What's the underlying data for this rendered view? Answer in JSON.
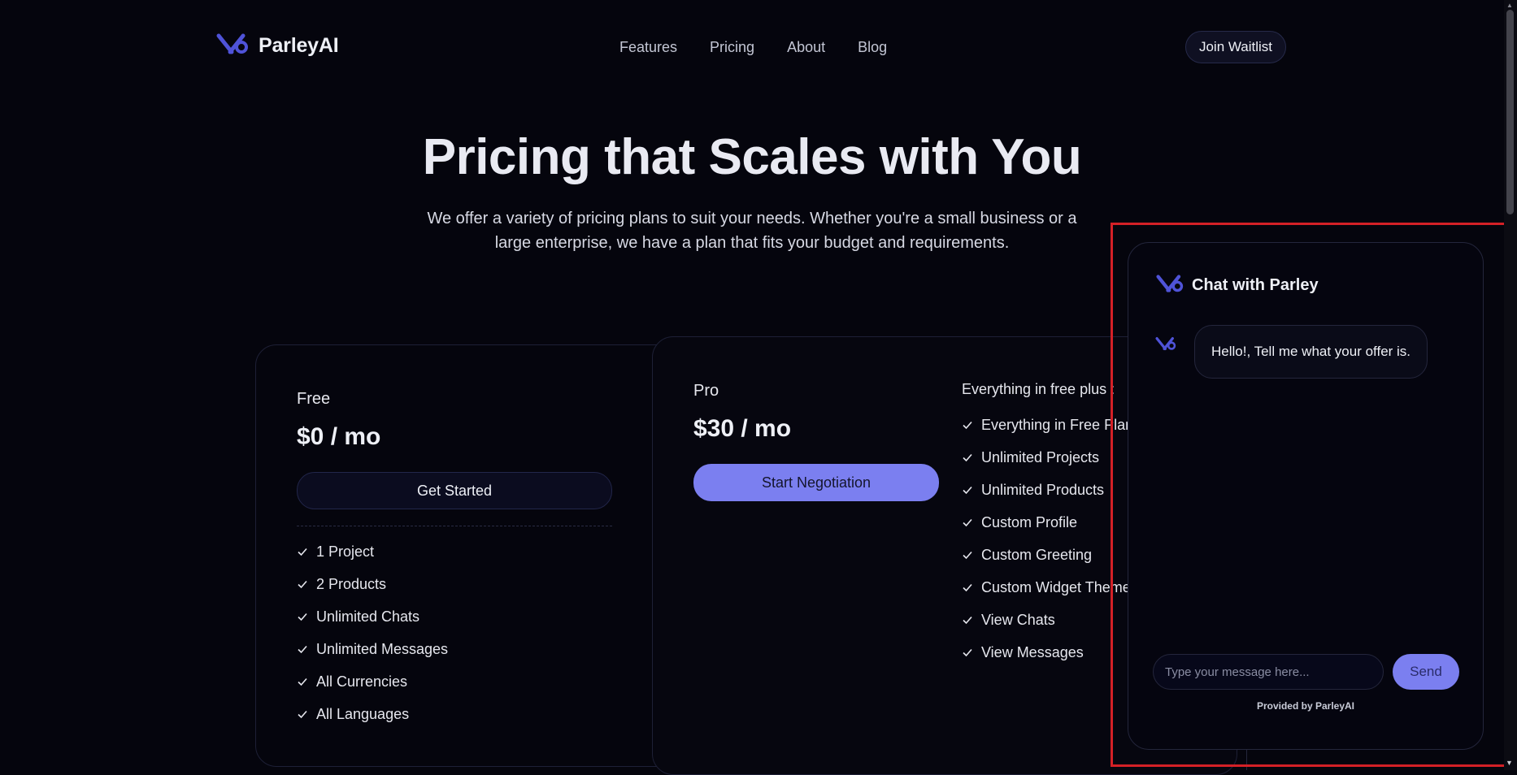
{
  "nav": {
    "brand_name": "ParleyAI",
    "links": [
      "Features",
      "Pricing",
      "About",
      "Blog"
    ],
    "cta": "Join Waitlist"
  },
  "hero": {
    "title": "Pricing that Scales with You",
    "subtitle": "We offer a variety of pricing plans to suit your needs. Whether you're a small business or a large enterprise, we have a plan that fits your budget and requirements."
  },
  "plans": {
    "free": {
      "name": "Free",
      "price": "$0 / mo",
      "button": "Get Started",
      "features": [
        "1 Project",
        "2 Products",
        "Unlimited Chats",
        "Unlimited Messages",
        "All Currencies",
        "All Languages"
      ]
    },
    "pro": {
      "name": "Pro",
      "price": "$30 / mo",
      "button": "Start Negotiation",
      "plus_label": "Everything in free plus :",
      "features": [
        "Everything in Free Plan",
        "Unlimited Projects",
        "Unlimited Products",
        "Custom Profile",
        "Custom Greeting",
        "Custom Widget Theme",
        "View Chats",
        "View Messages"
      ]
    }
  },
  "chat": {
    "title": "Chat with Parley",
    "message": "Hello!, Tell me what your offer is.",
    "input_placeholder": "Type your message here...",
    "send": "Send",
    "provided_by": "Provided by ParleyAI"
  },
  "colors": {
    "background": "#05050d",
    "accent": "#7b7ff0",
    "logo": "#4f53d8",
    "highlight_outline": "#d42026"
  },
  "icons": [
    "parley-logo-icon",
    "check-icon"
  ]
}
